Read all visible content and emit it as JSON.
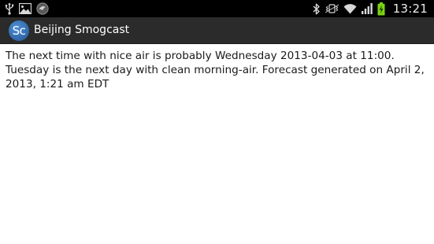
{
  "status_bar": {
    "time": "13:21",
    "left_icons": [
      "usb-icon",
      "image-icon",
      "app-notification-icon"
    ],
    "right_icons": [
      "bluetooth-icon",
      "vibrate-icon",
      "wifi-icon",
      "signal-icon",
      "battery-charging-icon"
    ]
  },
  "action_bar": {
    "app_icon_text": "Sc",
    "title": "Beijing Smogcast"
  },
  "content": {
    "forecast_text": "The next time with nice air is probably Wednesday 2013-04-03 at 11:00. Tuesday is the next day with clean morning-air. Forecast generated on April 2, 2013, 1:21 am EDT"
  },
  "colors": {
    "status_bar_bg": "#000000",
    "action_bar_bg": "#2b2b2b",
    "app_icon_blue": "#2f67a9",
    "battery_green": "#7bd313"
  }
}
